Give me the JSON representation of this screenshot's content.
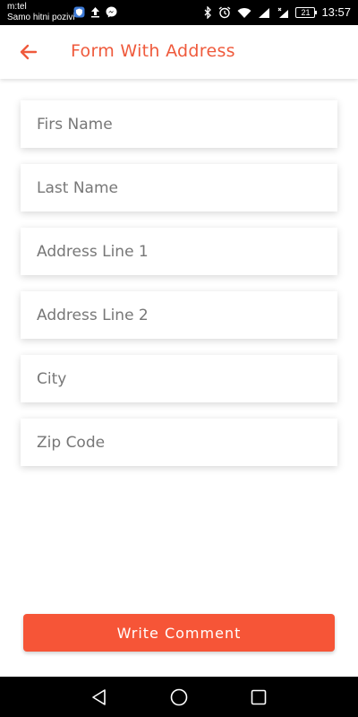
{
  "status_bar": {
    "carrier_line1": "m:tel",
    "carrier_line2": "Samo hitni pozivi",
    "battery": "21",
    "time": "13:57",
    "icons": [
      "shield-app-icon",
      "upload-icon",
      "messenger-icon",
      "bluetooth-icon",
      "alarm-icon",
      "wifi-icon",
      "signal-icon",
      "signal-off-icon",
      "battery-icon"
    ]
  },
  "app_bar": {
    "title": "Form With Address",
    "back_icon": "arrow-left-icon",
    "accent_color": "#ef5a3c"
  },
  "form": {
    "first_name_placeholder": "Firs Name",
    "last_name_placeholder": "Last Name",
    "address1_placeholder": "Address Line 1",
    "address2_placeholder": "Address Line 2",
    "city_placeholder": "City",
    "zip_placeholder": "Zip Code"
  },
  "submit": {
    "label": "Write Comment",
    "color": "#f65537"
  },
  "nav_bar": {
    "icons": [
      "back-triangle-icon",
      "home-circle-icon",
      "recents-square-icon"
    ]
  }
}
